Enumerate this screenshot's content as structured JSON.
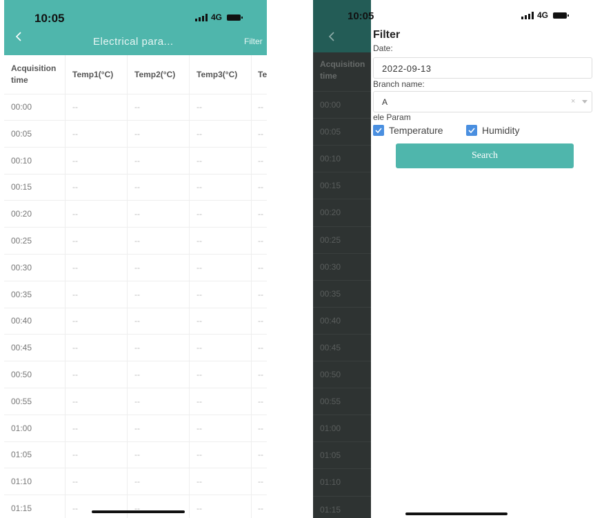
{
  "left_phone": {
    "status_time": "10:05",
    "network": "4G",
    "nav": {
      "title": "Electrical para...",
      "filter_label": "Filter"
    },
    "table": {
      "headers": [
        "Acquisition time",
        "Temp1(°C)",
        "Temp2(°C)",
        "Temp3(°C)",
        "Te"
      ],
      "rows": [
        [
          "00:00",
          "--",
          "--",
          "--",
          "--"
        ],
        [
          "00:05",
          "--",
          "--",
          "--",
          "--"
        ],
        [
          "00:10",
          "--",
          "--",
          "--",
          "--"
        ],
        [
          "00:15",
          "--",
          "--",
          "--",
          "--"
        ],
        [
          "00:20",
          "--",
          "--",
          "--",
          "--"
        ],
        [
          "00:25",
          "--",
          "--",
          "--",
          "--"
        ],
        [
          "00:30",
          "--",
          "--",
          "--",
          "--"
        ],
        [
          "00:35",
          "--",
          "--",
          "--",
          "--"
        ],
        [
          "00:40",
          "--",
          "--",
          "--",
          "--"
        ],
        [
          "00:45",
          "--",
          "--",
          "--",
          "--"
        ],
        [
          "00:50",
          "--",
          "--",
          "--",
          "--"
        ],
        [
          "00:55",
          "--",
          "--",
          "--",
          "--"
        ],
        [
          "01:00",
          "--",
          "--",
          "--",
          "--"
        ],
        [
          "01:05",
          "--",
          "--",
          "--",
          "--"
        ],
        [
          "01:10",
          "--",
          "--",
          "--",
          "--"
        ],
        [
          "01:15",
          "--",
          "--",
          "--",
          "--"
        ]
      ]
    }
  },
  "right_phone": {
    "status_time": "10:05",
    "network": "4G",
    "background_table": {
      "header": "Acquisition time",
      "times": [
        "00:00",
        "00:05",
        "00:10",
        "00:15",
        "00:20",
        "00:25",
        "00:30",
        "00:35",
        "00:40",
        "00:45",
        "00:50",
        "00:55",
        "01:00",
        "01:05",
        "01:10",
        "01:15"
      ]
    },
    "filter_panel": {
      "title": "Filter",
      "date_label": "Date:",
      "date_value": "2022-09-13",
      "branch_label": "Branch name:",
      "branch_value": "A",
      "clear_glyph": "×",
      "param_label": "ele Param",
      "checkboxes": [
        {
          "label": "Temperature",
          "checked": true
        },
        {
          "label": "Humidity",
          "checked": true
        }
      ],
      "search_label": "Search"
    }
  },
  "colors": {
    "teal": "#4fb6ac",
    "checkbox_blue": "#4a8fe0",
    "dim_overlay": "#2e3332"
  }
}
